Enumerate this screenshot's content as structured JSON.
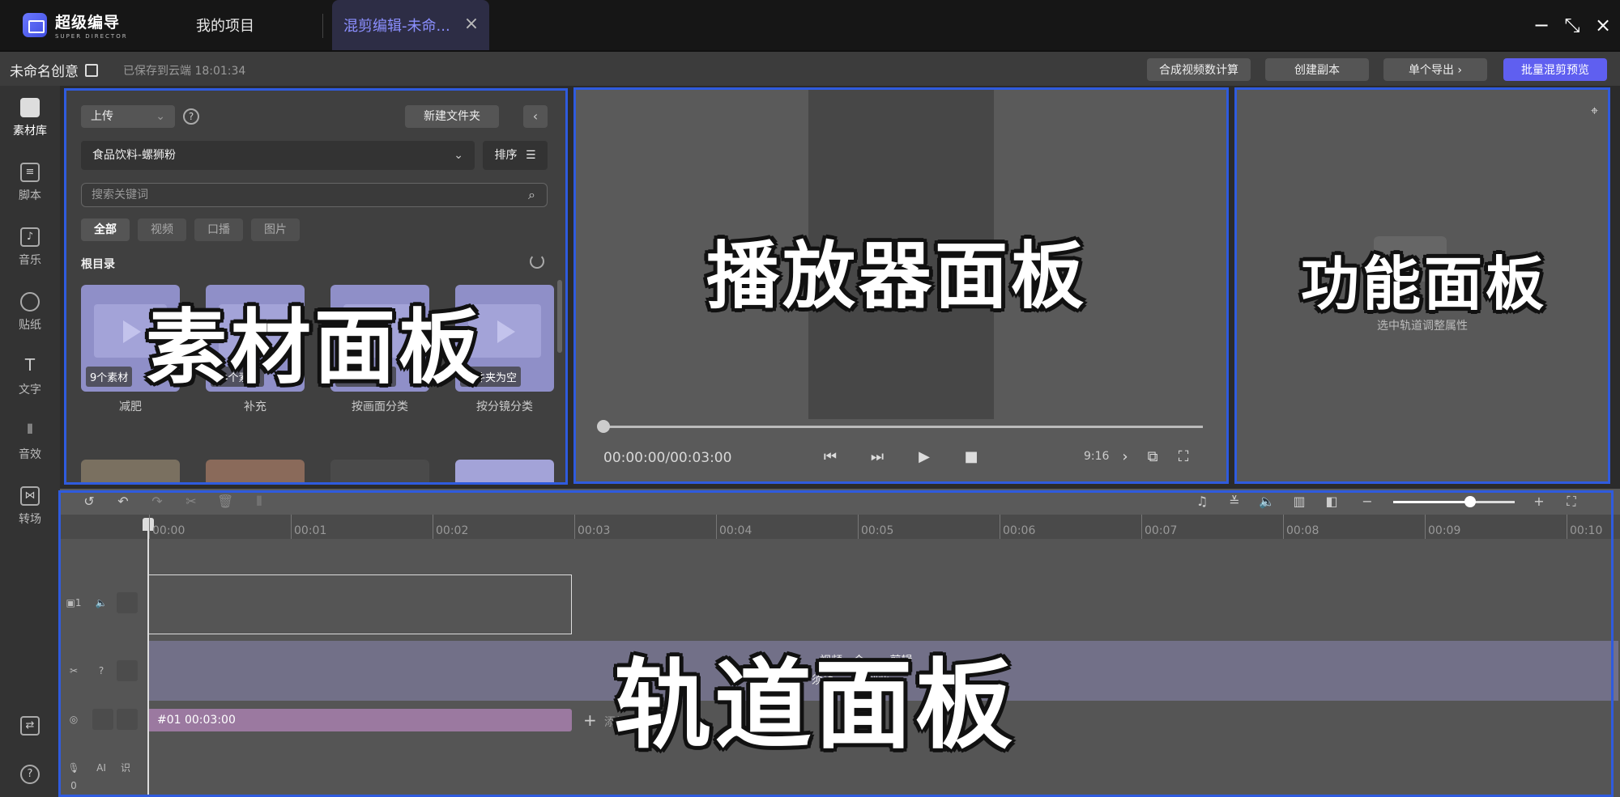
{
  "app": {
    "logo_cn": "超级编导",
    "logo_en": "SUPER DIRECTOR",
    "tab_projects": "我的项目",
    "tab_active": "混剪编辑-未命..."
  },
  "subbar": {
    "project_name": "未命名创意",
    "save_status": "已保存到云端 18:01:34",
    "buttons": [
      "合成视频数计算",
      "创建副本",
      "单个导出 ›",
      "批量混剪预览"
    ]
  },
  "rail": [
    {
      "label": "素材库",
      "icon": "library-icon"
    },
    {
      "label": "脚本",
      "icon": "script-icon"
    },
    {
      "label": "音乐",
      "icon": "music-icon"
    },
    {
      "label": "贴纸",
      "icon": "sticker-icon"
    },
    {
      "label": "文字",
      "icon": "text-icon"
    },
    {
      "label": "音效",
      "icon": "sound-effect-icon"
    },
    {
      "label": "转场",
      "icon": "transition-icon"
    }
  ],
  "material": {
    "upload": "上传",
    "new_folder": "新建文件夹",
    "category": "食品饮料-螺狮粉",
    "sort": "排序",
    "search_placeholder": "搜索关键词",
    "filters": [
      "全部",
      "视频",
      "口播",
      "图片"
    ],
    "root_label": "根目录",
    "cards": [
      {
        "badge": "9个素材",
        "label": "减肥"
      },
      {
        "badge": "14个素材",
        "label": "补充"
      },
      {
        "badge": "文件夹为空",
        "label": "按画面分类"
      },
      {
        "badge": "文件夹为空",
        "label": "按分镜分类"
      }
    ]
  },
  "player": {
    "timecode": "00:00:00/00:03:00",
    "ratio": "9:16"
  },
  "function": {
    "hint": "选中轨道调整属性"
  },
  "timeline": {
    "ticks": [
      "00:00",
      "00:01",
      "00:02",
      "00:03",
      "00:04",
      "00:05",
      "00:06",
      "00:07",
      "00:08",
      "00:09",
      "00:10"
    ],
    "track_v_label": "1",
    "track_a_label": "0",
    "text_track_line1": "视频 · 合 · · · 剪辑",
    "text_track_line2": "须轨 · · · · 到此",
    "audio_clip": "#01  00:03:00",
    "add_label": "添加"
  },
  "overlays": {
    "material": "素材面板",
    "player": "播放器面板",
    "function": "功能面板",
    "timeline": "轨道面板"
  },
  "colors": {
    "accent": "#5f5ff0",
    "outline": "#2f5bde",
    "card": "#8f8fc8",
    "audio_clip": "#9b79a0"
  }
}
